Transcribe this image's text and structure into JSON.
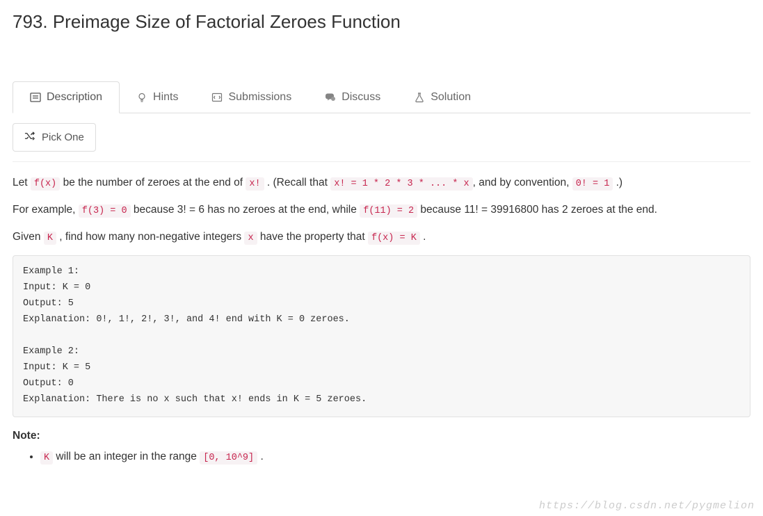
{
  "title": "793. Preimage Size of Factorial Zeroes Function",
  "tabs": {
    "description": "Description",
    "hints": "Hints",
    "submissions": "Submissions",
    "discuss": "Discuss",
    "solution": "Solution"
  },
  "pick_one": "Pick One",
  "body": {
    "p1_a": "Let ",
    "p1_code1": "f(x)",
    "p1_b": " be the number of zeroes at the end of ",
    "p1_code2": "x!",
    "p1_c": " . (Recall that ",
    "p1_code3": "x! = 1 * 2 * 3 * ... * x",
    "p1_d": ", and by convention, ",
    "p1_code4": "0! = 1",
    "p1_e": " .)",
    "p2_a": "For example, ",
    "p2_code1": "f(3) = 0",
    "p2_b": " because 3! = 6 has no zeroes at the end, while ",
    "p2_code2": "f(11) = 2",
    "p2_c": " because 11! = 39916800 has 2 zeroes at the end.",
    "p3_a": "Given ",
    "p3_code1": "K",
    "p3_b": " , find how many non-negative integers ",
    "p3_code2": "x",
    "p3_c": " have the property that ",
    "p3_code3": "f(x) = K",
    "p3_d": " ."
  },
  "example_block": "Example 1:\nInput: K = 0\nOutput: 5\nExplanation: 0!, 1!, 2!, 3!, and 4! end with K = 0 zeroes.\n\nExample 2:\nInput: K = 5\nOutput: 0\nExplanation: There is no x such that x! ends in K = 5 zeroes.",
  "note": {
    "title": "Note:",
    "item_a": " will be an integer in the range ",
    "item_code1": "K",
    "item_code2": "[0, 10^9]",
    "item_b": " ."
  },
  "watermark": "https://blog.csdn.net/pygmelion"
}
